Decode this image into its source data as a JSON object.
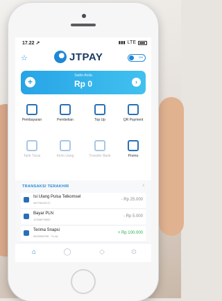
{
  "status_bar": {
    "time": "17.22 ↗",
    "network": "LTE"
  },
  "header": {
    "brand": "JTPAY",
    "toggle_label": "ON"
  },
  "balance": {
    "label": "Saldo Anda",
    "value": "Rp 0",
    "topup_symbol": "+",
    "next_symbol": "›"
  },
  "menu": {
    "row1": [
      {
        "label": "Pembayaran",
        "icon": "payment-icon"
      },
      {
        "label": "Pembelian",
        "icon": "purchase-icon"
      },
      {
        "label": "Top Up",
        "icon": "wallet-icon"
      },
      {
        "label": "QR Payment",
        "icon": "qr-icon"
      }
    ],
    "row2": [
      {
        "label": "Tarik Tunai",
        "icon": "cash-icon"
      },
      {
        "label": "Kirim Uang",
        "icon": "send-money-icon"
      },
      {
        "label": "Transfer Bank",
        "icon": "bank-icon"
      },
      {
        "label": "Promo",
        "icon": "promo-icon"
      }
    ]
  },
  "transactions": {
    "title": "TRANSAKSI TERAKHIR",
    "more": "›",
    "items": [
      {
        "title": "Isi Ulang Pulsa Telkomsel",
        "sub": "08778493172",
        "amount": "- Rp 25.000"
      },
      {
        "title": "Bayar PLN",
        "sub": "12345678900",
        "amount": "- Rp 5.000"
      },
      {
        "title": "Terima Snapsi",
        "sub": "0833068785 · Tv-kk",
        "amount": "+ Rp 100.000"
      }
    ]
  },
  "colors": {
    "brand": "#1e88d6",
    "card": "#27a4e6",
    "credit": "#2fae50"
  }
}
